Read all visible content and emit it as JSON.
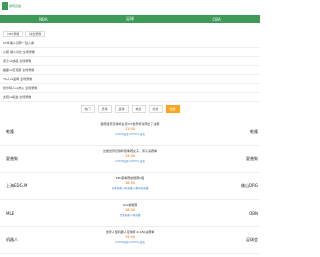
{
  "header": {
    "logo_text": "球吧直播",
    "nav": [
      "NBA",
      "足球",
      "CBA"
    ]
  },
  "chips": [
    "CBA录像",
    "综合录像"
  ],
  "list": [
    "05年湖人对阵一班人湖",
    "火箭 湖人对比 全场录像",
    "勇士vs快船 全场录像",
    "雄鹿vs尼克斯 全场录像",
    "76人vs篮网 全场录像",
    "凯尔特人vs热火 全场录像",
    "太阳vs掘金 全场录像"
  ],
  "filters": [
    "热门",
    "足球",
    "篮球",
    "电竞",
    "综合",
    "全部"
  ],
  "active_filter_index": 5,
  "games": [
    {
      "home": "乾隆",
      "title": "越南世界足球杯女足0:0世界杯对阵出了决赛",
      "time": "11:00",
      "link": "CCTV5高清 CCTV5+高清",
      "away": "乾隆"
    },
    {
      "home": "夏普狗",
      "title": "达能世界足球杯夏季赛女子、男子决赛季",
      "time": "13:00",
      "link": "CCTV5高清 CCTV5+高清",
      "away": "夏普狗"
    },
    {
      "home": "上海EDG.M",
      "title": "KPL夏季赛常规赛A组",
      "time": "16:00",
      "link": "虎牙直播 斗鱼直播 企鹅电竞直播",
      "away": "佛山DRG"
    },
    {
      "home": "MLE",
      "title": "LOL常规赛",
      "time": "18:00",
      "link": "虎牙直播 斗鱼直播",
      "away": "OBN"
    },
    {
      "home": "机器人",
      "title": "世界人型机器人足球杯.R.180决赛季",
      "time": "19:00",
      "link": "CCTV5高清 CCTV5+高清",
      "away": "足球会"
    }
  ]
}
